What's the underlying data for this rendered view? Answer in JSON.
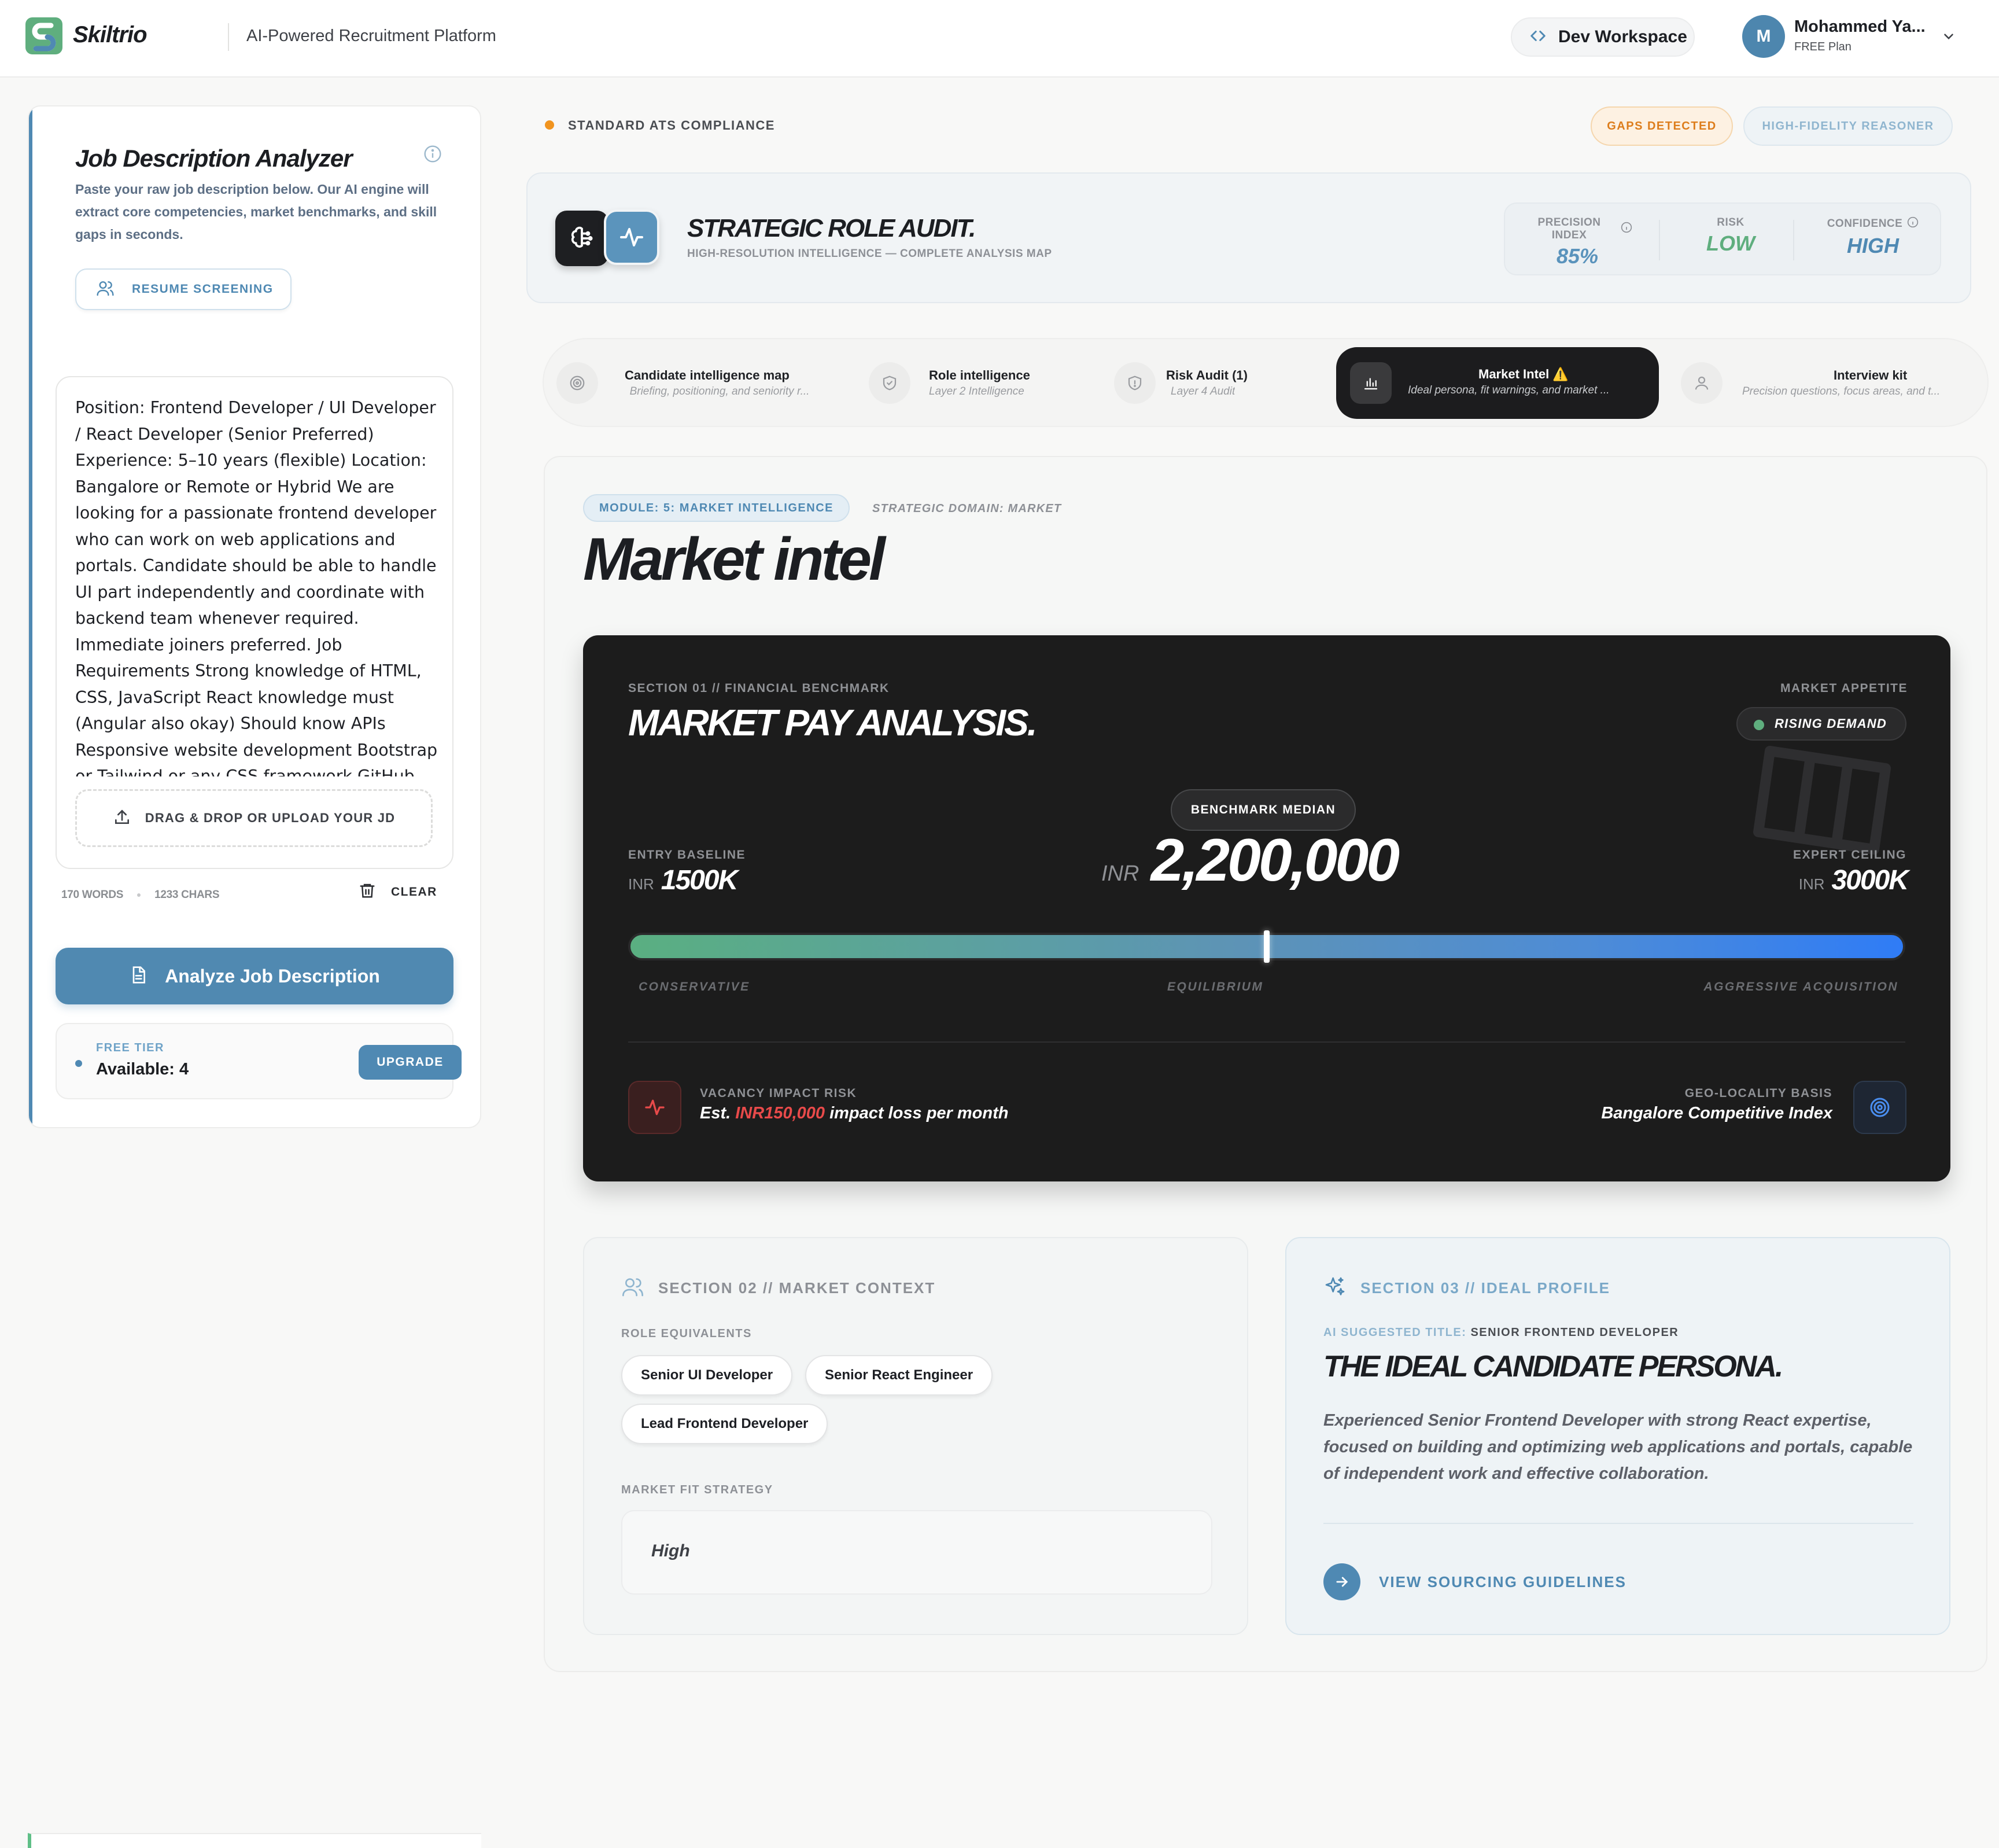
{
  "header": {
    "brand": "Skiltrio",
    "tagline": "AI-Powered Recruitment Platform",
    "workspace_label": "Dev Workspace",
    "user": {
      "initial": "M",
      "name": "Mohammed Ya...",
      "plan": "FREE Plan"
    }
  },
  "analyzer": {
    "title": "Job Description Analyzer",
    "description": "Paste your raw job description below. Our AI engine will extract core competencies, market benchmarks, and skill gaps in seconds.",
    "resume_button": "RESUME SCREENING",
    "jd_text": "Position: Frontend Developer / UI Developer / React Developer (Senior Preferred) Experience: 5–10 years (flexible) Location: Bangalore or Remote or Hybrid We are looking for a passionate frontend developer who can work on web applications and portals. Candidate should be able to handle UI part independently and coordinate with backend team whenever required. Immediate joiners preferred. Job Requirements Strong knowledge of HTML, CSS, JavaScript React knowledge must (Angular also okay) Should know APIs Responsive website development Bootstrap or Tailwind or any CSS framework GitHub usage Debugging skills Performance",
    "upload_label": "DRAG & DROP OR UPLOAD YOUR JD",
    "word_count": "170 WORDS",
    "char_count": "1233 CHARS",
    "clear_label": "CLEAR",
    "analyze_label": "Analyze Job Description",
    "tier_label": "FREE TIER",
    "tier_available": "Available: 4",
    "upgrade_label": "UPGRADE"
  },
  "status": {
    "compliance": "STANDARD ATS COMPLIANCE",
    "gaps_pill": "GAPS DETECTED",
    "reasoner_pill": "HIGH-FIDELITY REASONER"
  },
  "audit": {
    "title": "STRATEGIC ROLE AUDIT.",
    "subtitle": "HIGH-RESOLUTION INTELLIGENCE — COMPLETE ANALYSIS MAP",
    "precision_label": "PRECISION INDEX",
    "precision_value": "85%",
    "risk_label": "RISK",
    "risk_value": "LOW",
    "confidence_label": "CONFIDENCE",
    "confidence_value": "HIGH",
    "colors": {
      "precision": "#5a93bc",
      "risk": "#5fae7e",
      "confidence": "#4f89b3"
    }
  },
  "tabs": [
    {
      "title": "Candidate intelligence map",
      "sub": "Briefing, positioning, and seniority r...",
      "icon": "target-icon"
    },
    {
      "title": "Role intelligence",
      "sub": "Layer 2 Intelligence",
      "icon": "shield-check-icon"
    },
    {
      "title": "Risk Audit (1)",
      "sub": "Layer 4 Audit",
      "icon": "shield-alert-icon"
    },
    {
      "title": "Market Intel ⚠️",
      "sub": "Ideal persona, fit warnings, and market ...",
      "icon": "bar-chart-icon"
    },
    {
      "title": "Interview kit",
      "sub": "Precision questions, focus areas, and t...",
      "icon": "user-icon"
    }
  ],
  "module": {
    "tag": "MODULE: 5: MARKET INTELLIGENCE",
    "domain": "STRATEGIC DOMAIN: MARKET",
    "title": "Market intel"
  },
  "pay": {
    "kicker": "SECTION 01 // FINANCIAL BENCHMARK",
    "title": "MARKET PAY ANALYSIS.",
    "appetite_label": "MARKET APPETITE",
    "appetite_value": "RISING DEMAND",
    "median_label": "BENCHMARK MEDIAN",
    "currency": "INR",
    "median_value": "2,200,000",
    "entry_label": "ENTRY BASELINE",
    "entry_value": "1500K",
    "ceiling_label": "EXPERT CEILING",
    "ceiling_value": "3000K",
    "scale_labels": [
      "CONSERVATIVE",
      "EQUILIBRIUM",
      "AGGRESSIVE ACQUISITION"
    ],
    "vacancy_label": "VACANCY IMPACT RISK",
    "vacancy_prefix": "Est.",
    "vacancy_amount": "INR150,000",
    "vacancy_suffix": "impact loss per month",
    "geo_label": "GEO-LOCALITY BASIS",
    "geo_value": "Bangalore Competitive Index",
    "median_position": 0.5
  },
  "context": {
    "heading": "SECTION 02 // MARKET CONTEXT",
    "equivalents_label": "ROLE EQUIVALENTS",
    "equivalents": [
      "Senior UI Developer",
      "Senior React Engineer",
      "Lead Frontend Developer"
    ],
    "fit_label": "MARKET FIT STRATEGY",
    "fit_value": "High"
  },
  "profile": {
    "heading": "SECTION 03 // IDEAL PROFILE",
    "ai_title_label": "AI SUGGESTED TITLE:",
    "ai_title_value": "SENIOR FRONTEND DEVELOPER",
    "persona_title": "THE IDEAL CANDIDATE PERSONA.",
    "persona_desc": "Experienced Senior Frontend Developer with strong React expertise, focused on building and optimizing web applications and portals, capable of independent work and effective collaboration.",
    "sourcing_label": "VIEW SOURCING GUIDELINES"
  }
}
